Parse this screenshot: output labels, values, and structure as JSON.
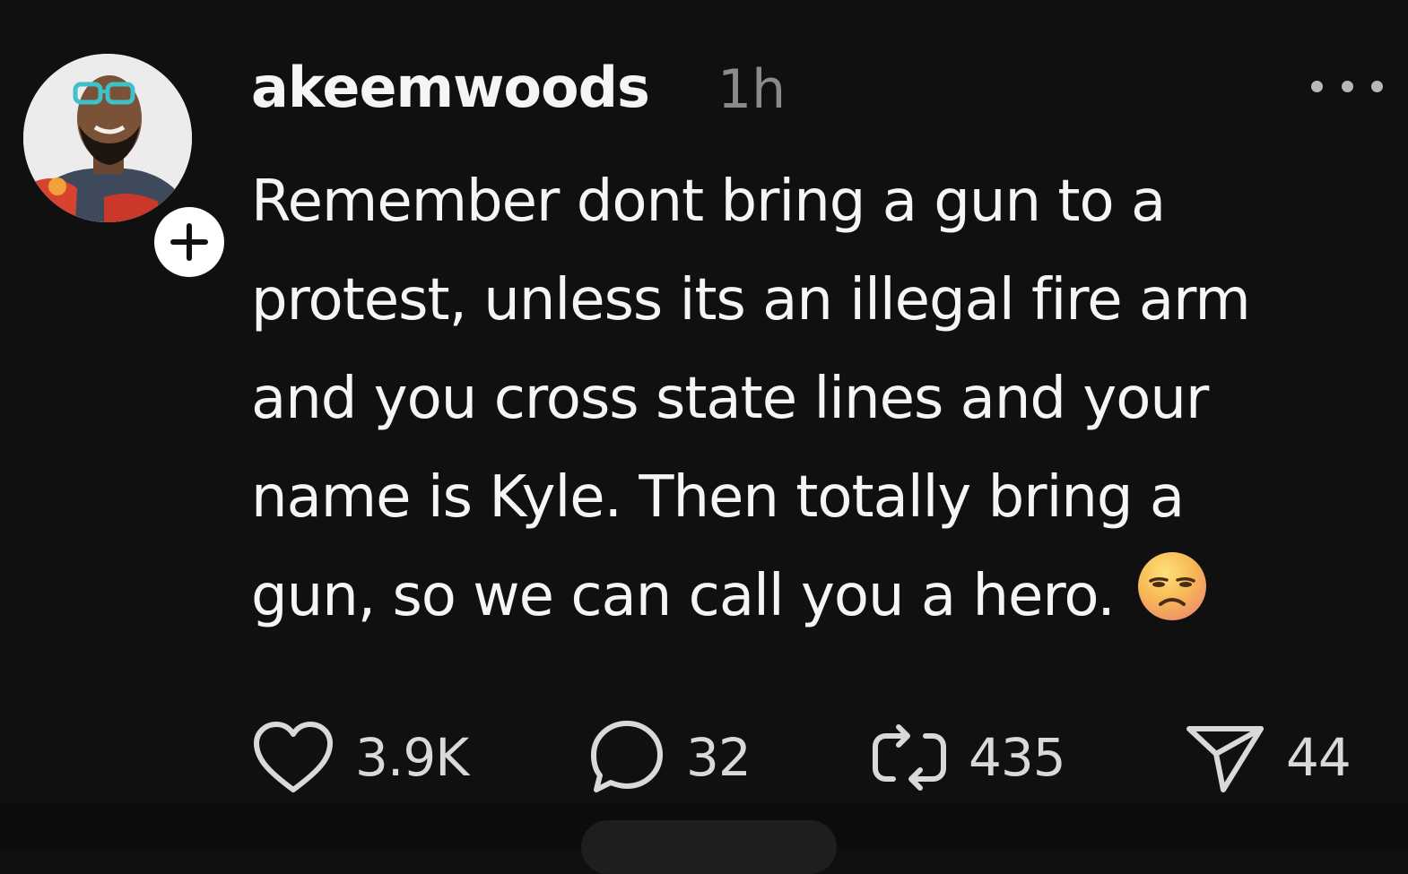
{
  "post": {
    "username": "akeemwoods",
    "timestamp": "1h",
    "text_lines": [
      "Remember dont bring a gun to a",
      "protest, unless its an illegal fire arm",
      "and you cross state lines and your",
      "name is Kyle. Then totally bring a",
      "gun, so we can call you a hero."
    ],
    "emoji": "unamused-sad-face"
  },
  "actions": {
    "likes": "3.9K",
    "replies": "32",
    "reposts": "435",
    "shares": "44"
  },
  "icons": {
    "more": "more-dots-icon",
    "follow": "plus-icon",
    "like": "heart-icon",
    "reply": "speech-bubble-icon",
    "repost": "repost-arrows-icon",
    "share": "paper-plane-icon"
  },
  "colors": {
    "background": "#101010",
    "text": "#f3f5f7",
    "muted": "#8a8a8a"
  }
}
